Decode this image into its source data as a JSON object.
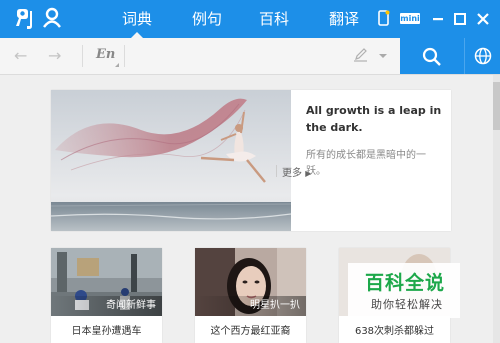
{
  "topbar": {
    "tabs": [
      {
        "label": "词典",
        "active": true
      },
      {
        "label": "例句",
        "active": false
      },
      {
        "label": "百科",
        "active": false
      },
      {
        "label": "翻译",
        "active": false
      }
    ],
    "mini_label": "mini",
    "accent_color": "#1d8fe8"
  },
  "search": {
    "language": "En",
    "value": "",
    "placeholder": ""
  },
  "hero": {
    "quote_en": "All growth is a leap in the dark.",
    "quote_zh": "所有的成长都是黑暗中的一跃。",
    "more_label": "更多"
  },
  "cards": [
    {
      "tag": "奇闻新鲜事",
      "title": "日本皇孙遭遇车"
    },
    {
      "tag": "明星扒一扒",
      "title": "这个西方最红亚裔"
    },
    {
      "tag": "",
      "title": "638次刺杀都躲过"
    }
  ],
  "watermark": {
    "main": "百科全说",
    "sub": "助你轻松解决",
    "color": "#1da84a"
  }
}
